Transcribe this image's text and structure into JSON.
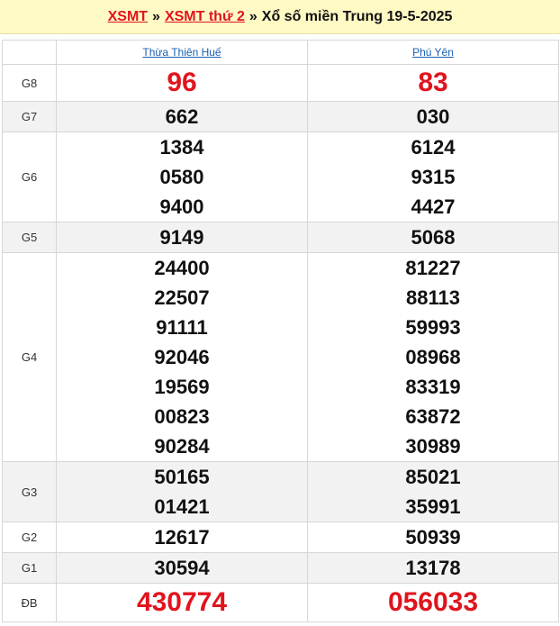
{
  "header": {
    "link1": "XSMT",
    "sep1": "»",
    "link2": "XSMT thứ 2",
    "sep2": "»",
    "title": "Xổ số miền Trung 19-5-2025"
  },
  "provinces": [
    "Thừa Thiên Huế",
    "Phú Yên"
  ],
  "prizes": [
    {
      "label": "G8",
      "col1": [
        "96"
      ],
      "col2": [
        "83"
      ]
    },
    {
      "label": "G7",
      "col1": [
        "662"
      ],
      "col2": [
        "030"
      ]
    },
    {
      "label": "G6",
      "col1": [
        "1384",
        "0580",
        "9400"
      ],
      "col2": [
        "6124",
        "9315",
        "4427"
      ]
    },
    {
      "label": "G5",
      "col1": [
        "9149"
      ],
      "col2": [
        "5068"
      ]
    },
    {
      "label": "G4",
      "col1": [
        "24400",
        "22507",
        "91111",
        "92046",
        "19569",
        "00823",
        "90284"
      ],
      "col2": [
        "81227",
        "88113",
        "59993",
        "08968",
        "83319",
        "63872",
        "30989"
      ]
    },
    {
      "label": "G3",
      "col1": [
        "50165",
        "01421"
      ],
      "col2": [
        "85021",
        "35991"
      ]
    },
    {
      "label": "G2",
      "col1": [
        "12617"
      ],
      "col2": [
        "50939"
      ]
    },
    {
      "label": "G1",
      "col1": [
        "30594"
      ],
      "col2": [
        "13178"
      ]
    },
    {
      "label": "ĐB",
      "col1": [
        "430774"
      ],
      "col2": [
        "056033"
      ]
    }
  ],
  "colors": {
    "accent": "#e0141e",
    "link": "#1a5fb4",
    "header_bg": "#fff9c4"
  }
}
